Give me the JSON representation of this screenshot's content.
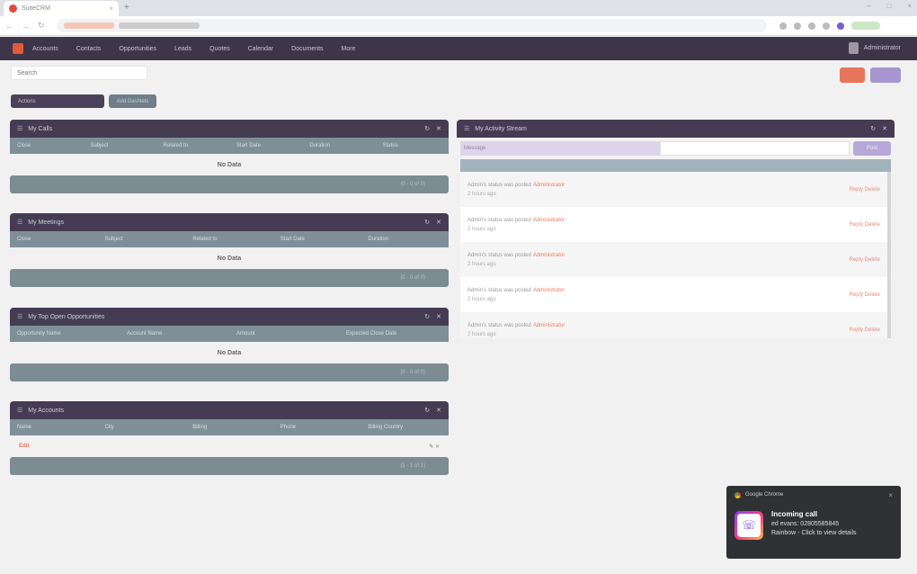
{
  "browser": {
    "tab_title": "SuiteCRM",
    "tab_close": "×",
    "new_tab": "+",
    "win_min": "–",
    "win_max": "□",
    "win_close": "×",
    "back": "←",
    "forward": "→",
    "reload": "↻"
  },
  "nav": {
    "items": [
      "Accounts",
      "Contacts",
      "Opportunities",
      "Leads",
      "Quotes",
      "Calendar",
      "Documents",
      "More"
    ],
    "user": "Administrator"
  },
  "toolbar": {
    "search_placeholder": "Search",
    "actions_label": "Actions",
    "add_dashlets_label": "Add Dashlets"
  },
  "dashlets": [
    {
      "title": "My Calls",
      "columns": [
        "Close",
        "Subject",
        "Related to",
        "Start Date",
        "Duration",
        "Status"
      ],
      "empty": "No Data",
      "footer": "(0 - 0 of 0)"
    },
    {
      "title": "My Meetings",
      "columns": [
        "Close",
        "Subject",
        "Related to",
        "Start Date",
        "Duration"
      ],
      "empty": "No Data",
      "footer": "(0 - 0 of 0)"
    },
    {
      "title": "My Top Open Opportunities",
      "columns": [
        "Opportunity Name",
        "Account Name",
        "Amount",
        "Expected Close Date"
      ],
      "empty": "No Data",
      "footer": "(0 - 0 of 0)"
    },
    {
      "title": "My Accounts",
      "columns": [
        "Name",
        "City",
        "Billing",
        "Phone",
        "Billing Country"
      ],
      "row_link": "Edit",
      "row_icons": "✎ ✕",
      "footer": "(1 - 1 of 1)"
    }
  ],
  "stream": {
    "title": "My Activity Stream",
    "filter_label": "Message",
    "post_label": "Post",
    "items": [
      {
        "text": "Admin's status was posted",
        "link": "Administrator",
        "sub": "2 hours ago",
        "right": "Reply Delete"
      },
      {
        "text": "Admin's status was posted",
        "link": "Administrator",
        "sub": "2 hours ago",
        "right": "Reply Delete"
      },
      {
        "text": "Admin's status was posted",
        "link": "Administrator",
        "sub": "2 hours ago",
        "right": "Reply Delete"
      },
      {
        "text": "Admin's status was posted",
        "link": "Administrator",
        "sub": "2 hours ago",
        "right": "Reply Delete"
      },
      {
        "text": "Admin's status was posted",
        "link": "Administrator",
        "sub": "2 hours ago",
        "right": "Reply Delete"
      }
    ]
  },
  "notification": {
    "source": "Google Chrome",
    "title": "Incoming call",
    "line1": "ed evans: 02805585845",
    "line2": "Rainbow - Click to view details",
    "close": "×"
  },
  "colors": {
    "nav_bg": "#3d3548",
    "dashlet_header": "#453c54",
    "accent_orange": "#e9745c",
    "accent_purple": "#a795cf"
  }
}
